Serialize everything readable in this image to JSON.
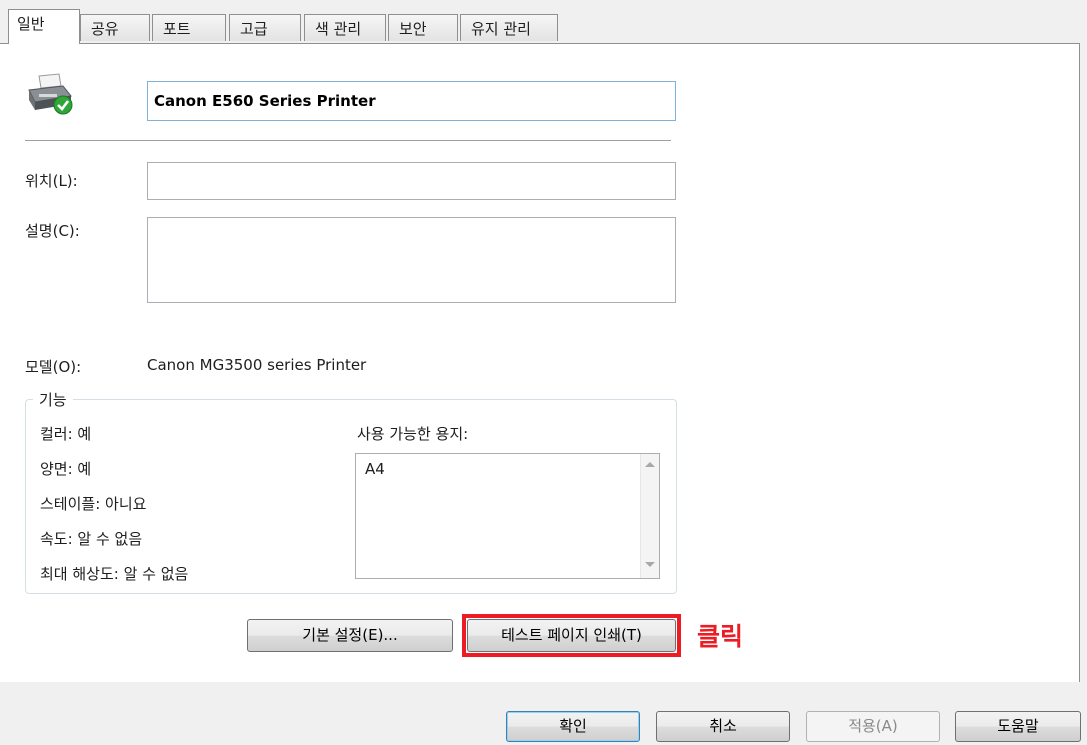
{
  "tabs": [
    {
      "label": "일반",
      "active": true
    },
    {
      "label": "공유",
      "active": false
    },
    {
      "label": "포트",
      "active": false
    },
    {
      "label": "고급",
      "active": false
    },
    {
      "label": "색 관리",
      "active": false
    },
    {
      "label": "보안",
      "active": false
    },
    {
      "label": "유지 관리",
      "active": false
    }
  ],
  "general": {
    "icon": "printer-ready-icon",
    "printer_name": "Canon E560 Series Printer",
    "location_label": "위치(L):",
    "location_value": "",
    "comment_label": "설명(C):",
    "comment_value": "",
    "model_label": "모델(O):",
    "model_value": "Canon MG3500 series Printer"
  },
  "features": {
    "title": "기능",
    "color": "컬러: 예",
    "duplex": "양면: 예",
    "staple": "스테이플: 아니요",
    "speed": "속도: 알 수 없음",
    "max_resolution": "최대 해상도: 알 수 없음",
    "paper_label": "사용 가능한 용지:",
    "papers": [
      "A4"
    ]
  },
  "buttons": {
    "preferences": "기본 설정(E)...",
    "print_test_page": "테스트 페이지 인쇄(T)",
    "ok": "확인",
    "cancel": "취소",
    "apply": "적용(A)",
    "help": "도움말"
  },
  "annotation": {
    "note": "클릭",
    "color": "#ed1c24"
  }
}
